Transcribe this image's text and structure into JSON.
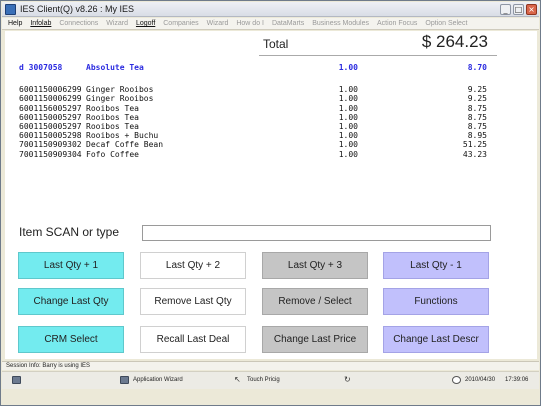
{
  "window": {
    "title": "IES Client(Q) v8.26 : My IES",
    "minimize": "_",
    "restore": "□",
    "close": "×"
  },
  "menu": [
    {
      "label": "Help",
      "enabled": true,
      "underline": false
    },
    {
      "label": "Infolab",
      "enabled": true,
      "underline": true
    },
    {
      "label": "Connections",
      "enabled": false,
      "underline": false
    },
    {
      "label": "Wizard",
      "enabled": false,
      "underline": false
    },
    {
      "label": "Logoff",
      "enabled": true,
      "underline": true
    },
    {
      "label": "Companies",
      "enabled": false,
      "underline": false
    },
    {
      "label": "Wizard",
      "enabled": false,
      "underline": false
    },
    {
      "label": "How do I",
      "enabled": false,
      "underline": false
    },
    {
      "label": "DataMarts",
      "enabled": false,
      "underline": false
    },
    {
      "label": "Business Modules",
      "enabled": false,
      "underline": false
    },
    {
      "label": "Action Focus",
      "enabled": false,
      "underline": false
    },
    {
      "label": "Option Select",
      "enabled": false,
      "underline": false
    }
  ],
  "total": {
    "label": "Total",
    "amount": "$ 264.23"
  },
  "items": [
    {
      "code": "d 3007058",
      "description": "Absolute Tea",
      "qty": "1.00",
      "amount": "8.70",
      "highlight": true
    },
    {
      "code": "6001150006299",
      "description": "Ginger Rooibos",
      "qty": "1.00",
      "amount": "9.25"
    },
    {
      "code": "6001150006299",
      "description": "Ginger Rooibos",
      "qty": "1.00",
      "amount": "9.25"
    },
    {
      "code": "6001156005297",
      "description": "Rooibos Tea",
      "qty": "1.00",
      "amount": "8.75"
    },
    {
      "code": "6001150005297",
      "description": "Rooibos Tea",
      "qty": "1.00",
      "amount": "8.75"
    },
    {
      "code": "6001150005297",
      "description": "Rooibos Tea",
      "qty": "1.00",
      "amount": "8.75"
    },
    {
      "code": "6001150005298",
      "description": "Rooibos + Buchu",
      "qty": "1.00",
      "amount": "8.95"
    },
    {
      "code": "7001150909302",
      "description": "Decaf Coffe Bean",
      "qty": "1.00",
      "amount": "51.25"
    },
    {
      "code": "7001150909304",
      "description": "Fofo Coffee",
      "qty": "1.00",
      "amount": "43.23"
    }
  ],
  "scan": {
    "label": "Item SCAN or type",
    "value": ""
  },
  "buttons": {
    "last_qty_plus_1": "Last Qty + 1",
    "last_qty_plus_2": "Last Qty + 2",
    "last_qty_plus_3": "Last Qty + 3",
    "last_qty_minus_1": "Last Qty - 1",
    "change_last_qty": "Change Last Qty",
    "remove_last_qty": "Remove Last Qty",
    "remove_select": "Remove / Select",
    "functions": "Functions",
    "crm_select": "CRM Select",
    "recall_last_deal": "Recall Last Deal",
    "change_last_price": "Change Last Price",
    "change_last_descr": "Change Last Descr"
  },
  "colors": {
    "cyan": "#73ebef",
    "gray": "#c5c5c5",
    "lavender": "#c1c0fc",
    "highlight_text": "#2b2be0"
  },
  "session": {
    "text": "Session Info: Barry is using IES"
  },
  "taskbar": {
    "app_wizard": "Application Wizard",
    "touch_pricing": "Touch Pricig",
    "date": "2010/04/30",
    "time": "17:39:06"
  }
}
